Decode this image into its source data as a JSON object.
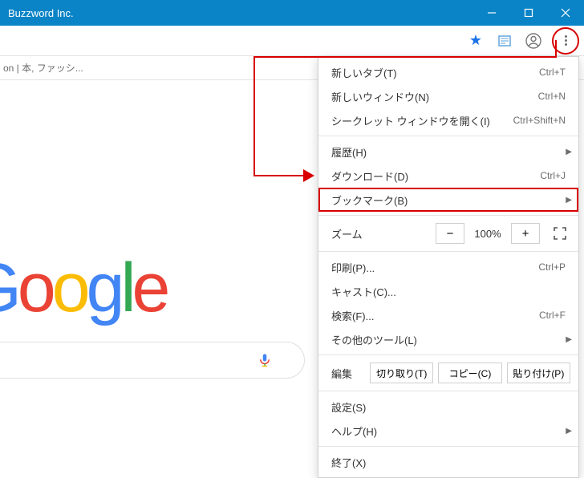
{
  "titlebar": {
    "title": "Buzzword Inc."
  },
  "bookmarks_bar": {
    "text": "on | 本, ファッシ..."
  },
  "menu": {
    "new_tab": {
      "label": "新しいタブ(T)",
      "shortcut": "Ctrl+T"
    },
    "new_window": {
      "label": "新しいウィンドウ(N)",
      "shortcut": "Ctrl+N"
    },
    "incognito": {
      "label": "シークレット ウィンドウを開く(I)",
      "shortcut": "Ctrl+Shift+N"
    },
    "history": {
      "label": "履歴(H)"
    },
    "downloads": {
      "label": "ダウンロード(D)",
      "shortcut": "Ctrl+J"
    },
    "bookmarks": {
      "label": "ブックマーク(B)"
    },
    "zoom": {
      "label": "ズーム",
      "value": "100%",
      "minus": "−",
      "plus": "+"
    },
    "print": {
      "label": "印刷(P)...",
      "shortcut": "Ctrl+P"
    },
    "cast": {
      "label": "キャスト(C)..."
    },
    "find": {
      "label": "検索(F)...",
      "shortcut": "Ctrl+F"
    },
    "more_tools": {
      "label": "その他のツール(L)"
    },
    "edit": {
      "label": "編集",
      "cut": "切り取り(T)",
      "copy": "コピー(C)",
      "paste": "貼り付け(P)"
    },
    "settings": {
      "label": "設定(S)"
    },
    "help": {
      "label": "ヘルプ(H)"
    },
    "exit": {
      "label": "終了(X)"
    }
  },
  "logo": {
    "text": "Google"
  }
}
